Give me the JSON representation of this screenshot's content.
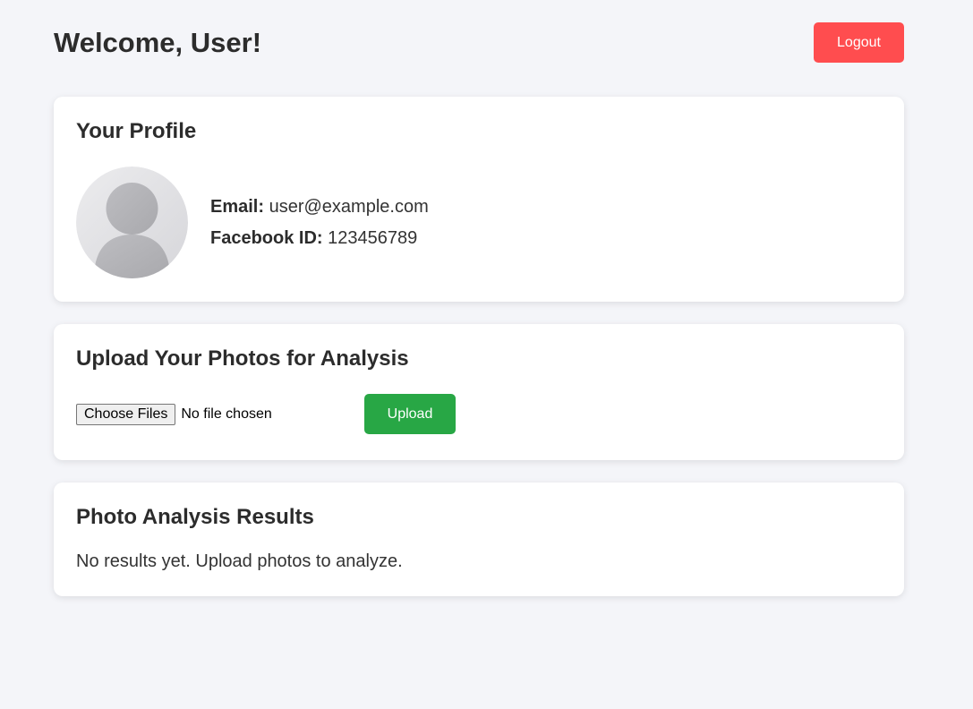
{
  "header": {
    "title": "Welcome, User!",
    "logout_label": "Logout"
  },
  "profile": {
    "title": "Your Profile",
    "avatar_icon": "user-avatar-icon",
    "email_label": "Email:",
    "email_value": "user@example.com",
    "facebook_label": "Facebook ID:",
    "facebook_value": "123456789"
  },
  "upload": {
    "title": "Upload Your Photos for Analysis",
    "choose_files_label": "Choose Files",
    "file_status": "No file chosen",
    "upload_label": "Upload"
  },
  "results": {
    "title": "Photo Analysis Results",
    "empty_text": "No results yet. Upload photos to analyze."
  },
  "colors": {
    "background": "#f4f5f9",
    "logout": "#ff4d4f",
    "upload": "#28a745",
    "card": "#ffffff"
  }
}
